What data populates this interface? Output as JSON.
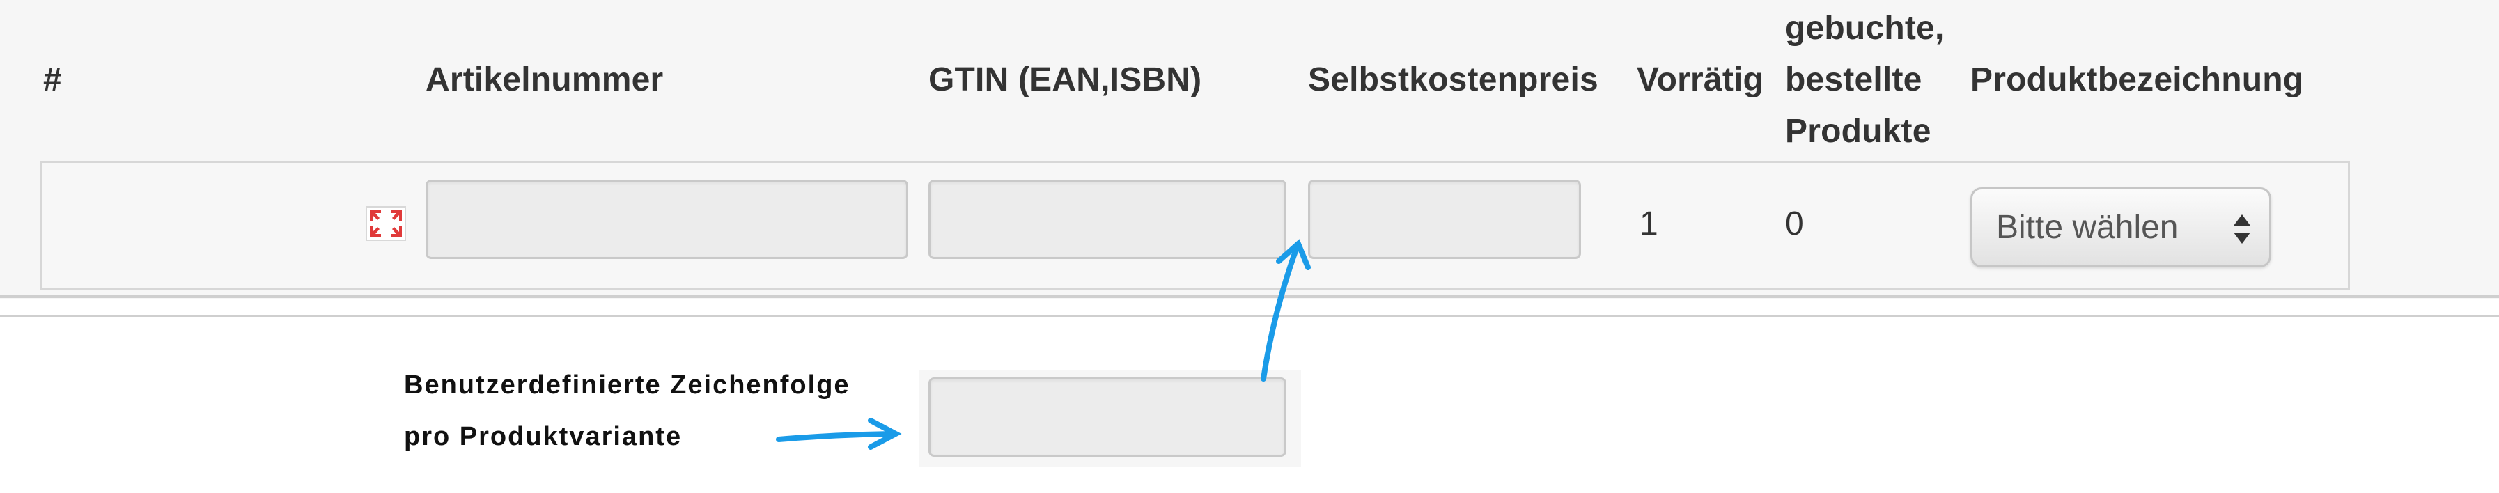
{
  "table": {
    "headers": {
      "index": "#",
      "article_number": "Artikelnummer",
      "gtin": "GTIN (EAN,ISBN)",
      "cost_price": "Selbstkostenpreis",
      "in_stock": "Vorrätig",
      "booked_line1": "gebuchte,",
      "booked_line2": "bestellte",
      "booked_line3": "Produkte",
      "product_name": "Produktbezeichnung"
    },
    "rows": [
      {
        "row_icon": "broken-image-icon",
        "article_number_value": "",
        "gtin_value": "",
        "cost_price_value": "",
        "in_stock": "1",
        "booked": "0",
        "product_name_select": "Bitte wählen"
      }
    ]
  },
  "annotation": {
    "line1": "Benutzerdefinierte Zeichenfolge",
    "line2": "pro Produktvariante",
    "custom_string_value": "",
    "arrow_color": "#1a9be8"
  },
  "colors": {
    "panel_background": "#f6f6f6",
    "field_background": "#ececec",
    "field_border": "#c9c9c9",
    "arrow": "#1a9be8",
    "broken_icon": "#e03a3a"
  }
}
